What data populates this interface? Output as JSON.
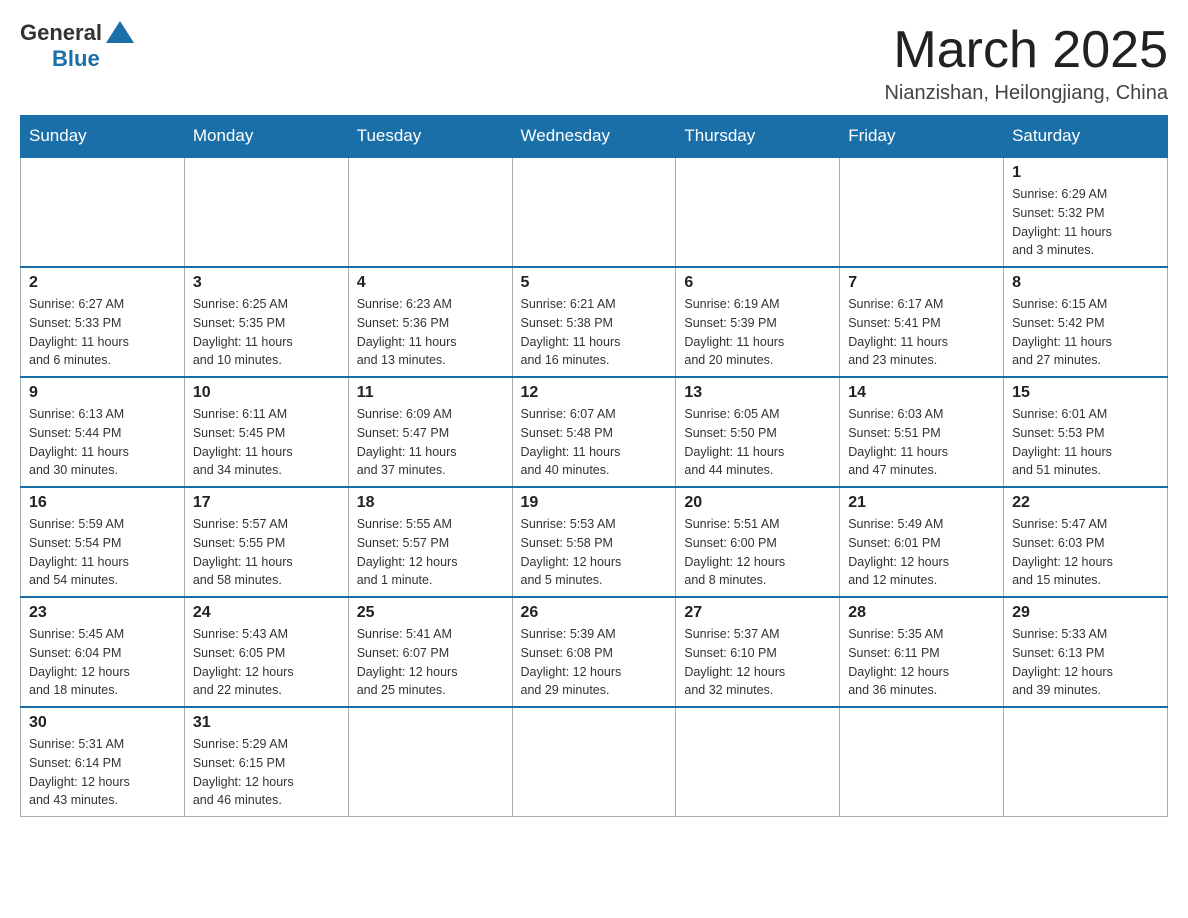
{
  "header": {
    "logo_general": "General",
    "logo_blue": "Blue",
    "month_year": "March 2025",
    "location": "Nianzishan, Heilongjiang, China"
  },
  "weekdays": [
    "Sunday",
    "Monday",
    "Tuesday",
    "Wednesday",
    "Thursday",
    "Friday",
    "Saturday"
  ],
  "weeks": [
    [
      {
        "day": "",
        "info": ""
      },
      {
        "day": "",
        "info": ""
      },
      {
        "day": "",
        "info": ""
      },
      {
        "day": "",
        "info": ""
      },
      {
        "day": "",
        "info": ""
      },
      {
        "day": "",
        "info": ""
      },
      {
        "day": "1",
        "info": "Sunrise: 6:29 AM\nSunset: 5:32 PM\nDaylight: 11 hours\nand 3 minutes."
      }
    ],
    [
      {
        "day": "2",
        "info": "Sunrise: 6:27 AM\nSunset: 5:33 PM\nDaylight: 11 hours\nand 6 minutes."
      },
      {
        "day": "3",
        "info": "Sunrise: 6:25 AM\nSunset: 5:35 PM\nDaylight: 11 hours\nand 10 minutes."
      },
      {
        "day": "4",
        "info": "Sunrise: 6:23 AM\nSunset: 5:36 PM\nDaylight: 11 hours\nand 13 minutes."
      },
      {
        "day": "5",
        "info": "Sunrise: 6:21 AM\nSunset: 5:38 PM\nDaylight: 11 hours\nand 16 minutes."
      },
      {
        "day": "6",
        "info": "Sunrise: 6:19 AM\nSunset: 5:39 PM\nDaylight: 11 hours\nand 20 minutes."
      },
      {
        "day": "7",
        "info": "Sunrise: 6:17 AM\nSunset: 5:41 PM\nDaylight: 11 hours\nand 23 minutes."
      },
      {
        "day": "8",
        "info": "Sunrise: 6:15 AM\nSunset: 5:42 PM\nDaylight: 11 hours\nand 27 minutes."
      }
    ],
    [
      {
        "day": "9",
        "info": "Sunrise: 6:13 AM\nSunset: 5:44 PM\nDaylight: 11 hours\nand 30 minutes."
      },
      {
        "day": "10",
        "info": "Sunrise: 6:11 AM\nSunset: 5:45 PM\nDaylight: 11 hours\nand 34 minutes."
      },
      {
        "day": "11",
        "info": "Sunrise: 6:09 AM\nSunset: 5:47 PM\nDaylight: 11 hours\nand 37 minutes."
      },
      {
        "day": "12",
        "info": "Sunrise: 6:07 AM\nSunset: 5:48 PM\nDaylight: 11 hours\nand 40 minutes."
      },
      {
        "day": "13",
        "info": "Sunrise: 6:05 AM\nSunset: 5:50 PM\nDaylight: 11 hours\nand 44 minutes."
      },
      {
        "day": "14",
        "info": "Sunrise: 6:03 AM\nSunset: 5:51 PM\nDaylight: 11 hours\nand 47 minutes."
      },
      {
        "day": "15",
        "info": "Sunrise: 6:01 AM\nSunset: 5:53 PM\nDaylight: 11 hours\nand 51 minutes."
      }
    ],
    [
      {
        "day": "16",
        "info": "Sunrise: 5:59 AM\nSunset: 5:54 PM\nDaylight: 11 hours\nand 54 minutes."
      },
      {
        "day": "17",
        "info": "Sunrise: 5:57 AM\nSunset: 5:55 PM\nDaylight: 11 hours\nand 58 minutes."
      },
      {
        "day": "18",
        "info": "Sunrise: 5:55 AM\nSunset: 5:57 PM\nDaylight: 12 hours\nand 1 minute."
      },
      {
        "day": "19",
        "info": "Sunrise: 5:53 AM\nSunset: 5:58 PM\nDaylight: 12 hours\nand 5 minutes."
      },
      {
        "day": "20",
        "info": "Sunrise: 5:51 AM\nSunset: 6:00 PM\nDaylight: 12 hours\nand 8 minutes."
      },
      {
        "day": "21",
        "info": "Sunrise: 5:49 AM\nSunset: 6:01 PM\nDaylight: 12 hours\nand 12 minutes."
      },
      {
        "day": "22",
        "info": "Sunrise: 5:47 AM\nSunset: 6:03 PM\nDaylight: 12 hours\nand 15 minutes."
      }
    ],
    [
      {
        "day": "23",
        "info": "Sunrise: 5:45 AM\nSunset: 6:04 PM\nDaylight: 12 hours\nand 18 minutes."
      },
      {
        "day": "24",
        "info": "Sunrise: 5:43 AM\nSunset: 6:05 PM\nDaylight: 12 hours\nand 22 minutes."
      },
      {
        "day": "25",
        "info": "Sunrise: 5:41 AM\nSunset: 6:07 PM\nDaylight: 12 hours\nand 25 minutes."
      },
      {
        "day": "26",
        "info": "Sunrise: 5:39 AM\nSunset: 6:08 PM\nDaylight: 12 hours\nand 29 minutes."
      },
      {
        "day": "27",
        "info": "Sunrise: 5:37 AM\nSunset: 6:10 PM\nDaylight: 12 hours\nand 32 minutes."
      },
      {
        "day": "28",
        "info": "Sunrise: 5:35 AM\nSunset: 6:11 PM\nDaylight: 12 hours\nand 36 minutes."
      },
      {
        "day": "29",
        "info": "Sunrise: 5:33 AM\nSunset: 6:13 PM\nDaylight: 12 hours\nand 39 minutes."
      }
    ],
    [
      {
        "day": "30",
        "info": "Sunrise: 5:31 AM\nSunset: 6:14 PM\nDaylight: 12 hours\nand 43 minutes."
      },
      {
        "day": "31",
        "info": "Sunrise: 5:29 AM\nSunset: 6:15 PM\nDaylight: 12 hours\nand 46 minutes."
      },
      {
        "day": "",
        "info": ""
      },
      {
        "day": "",
        "info": ""
      },
      {
        "day": "",
        "info": ""
      },
      {
        "day": "",
        "info": ""
      },
      {
        "day": "",
        "info": ""
      }
    ]
  ]
}
